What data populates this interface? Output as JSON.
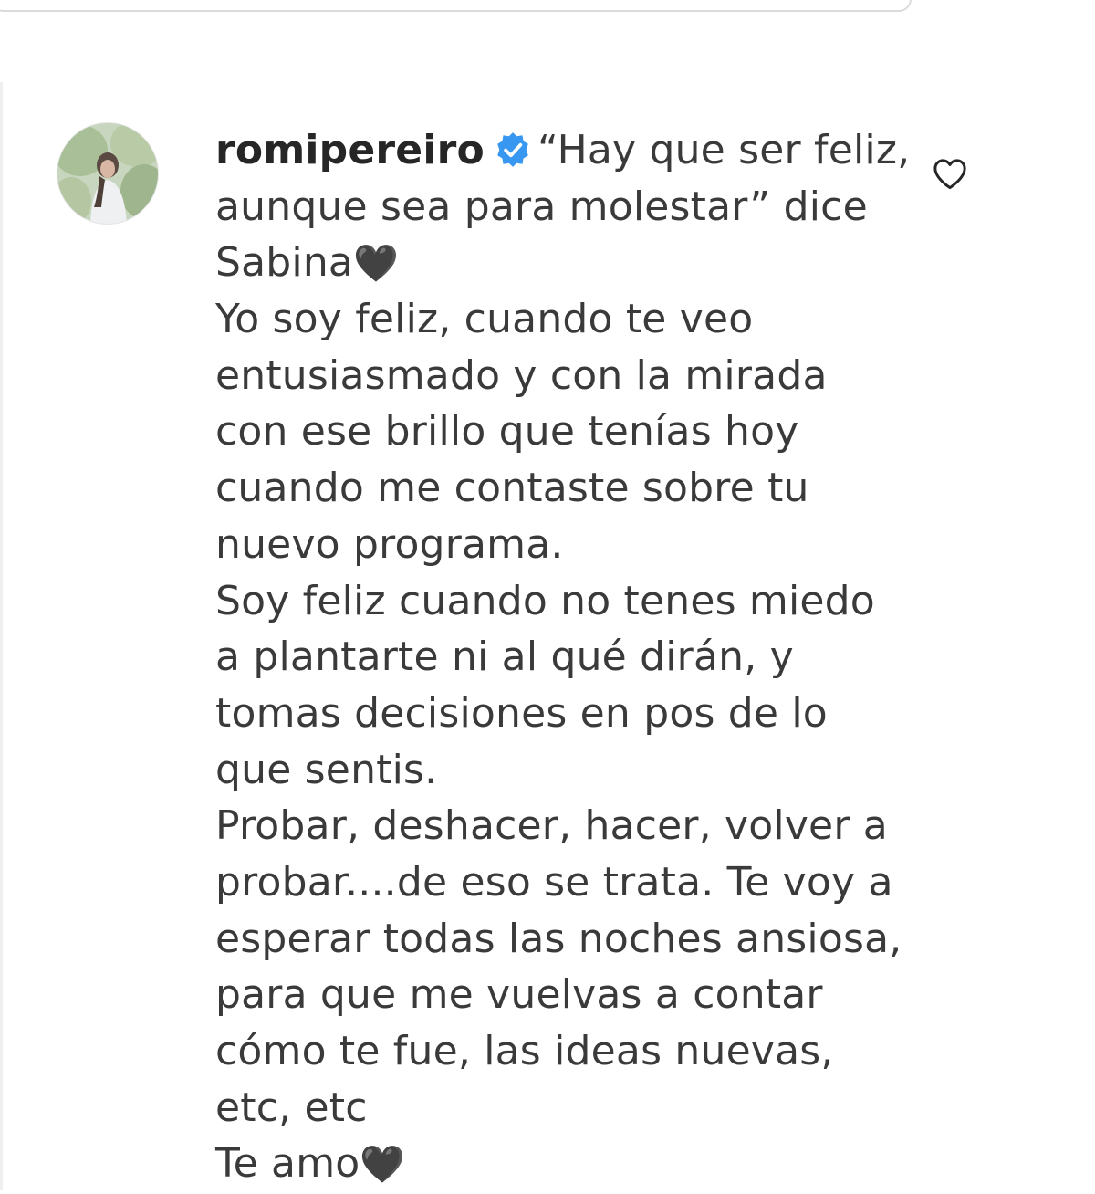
{
  "comment": {
    "username": "romipereiro",
    "first_line_text": "“Hay que ser feliz,",
    "lines": [
      "aunque sea para molestar” dice",
      "Sabina",
      "Yo soy feliz, cuando te veo",
      "entusiasmado y con la mirada",
      "con ese brillo que tenías hoy",
      "cuando me contaste sobre tu",
      "nuevo programa.",
      "Soy feliz cuando no tenes miedo",
      "a plantarte ni al qué dirán, y",
      "tomas decisiones en pos de lo",
      "que sentis.",
      "Probar, deshacer, hacer, volver a",
      "probar....de eso se trata. Te voy a",
      "esperar todas las noches ansiosa,",
      "para que me vuelvas a contar",
      "cómo te fue, las ideas nuevas,",
      "etc, etc",
      "Te amo"
    ],
    "emoji": "🖤"
  },
  "icons": {
    "verified": "verified-badge-icon",
    "like": "heart-outline-icon",
    "avatar": "profile-avatar"
  },
  "colors": {
    "verified_blue": "#3897f0",
    "text": "#262626",
    "border": "#dbdbdb"
  }
}
